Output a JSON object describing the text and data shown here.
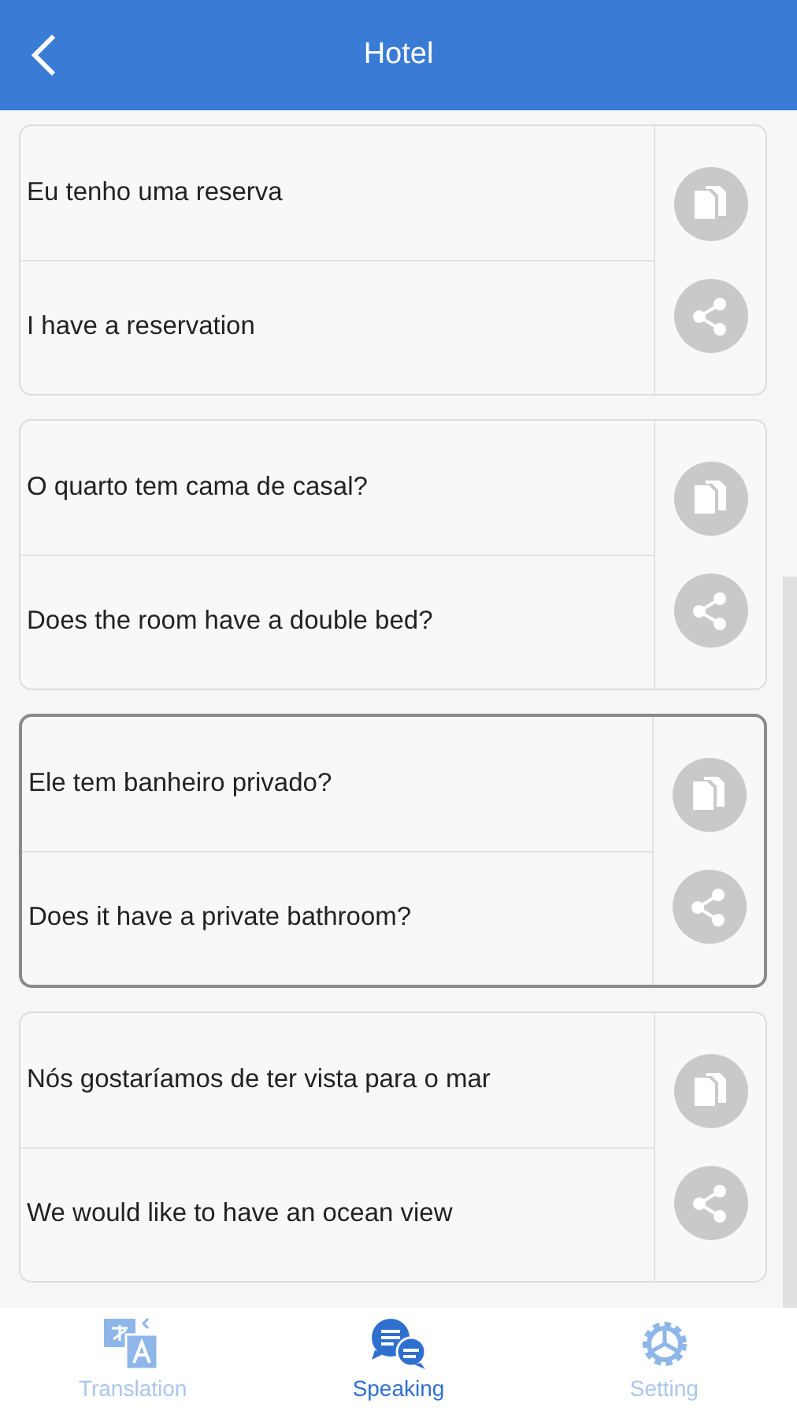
{
  "header": {
    "title": "Hotel"
  },
  "phrases": [
    {
      "original": "Eu tenho uma reserva",
      "translation": "I have a reservation",
      "selected": false
    },
    {
      "original": "O quarto tem cama de casal?",
      "translation": "Does the room have a double bed?",
      "selected": false
    },
    {
      "original": "Ele tem banheiro privado?",
      "translation": "Does it have a private bathroom?",
      "selected": true
    },
    {
      "original": "Nós gostaríamos de ter vista para o mar",
      "translation": "We would like to have an ocean view",
      "selected": false
    }
  ],
  "tabs": [
    {
      "kind": "translation",
      "label": "Translation",
      "selected": false
    },
    {
      "kind": "speaking",
      "label": "Speaking",
      "selected": true
    },
    {
      "kind": "setting",
      "label": "Setting",
      "selected": false
    }
  ]
}
